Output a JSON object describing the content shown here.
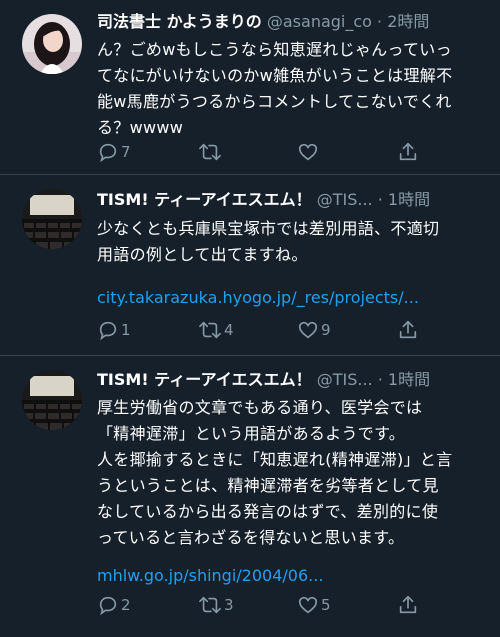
{
  "colors": {
    "background": "#15202b",
    "text": "#ffffff",
    "muted": "#8899a6",
    "link": "#1da1f2",
    "divider": "#38444d"
  },
  "tweets": [
    {
      "name": "司法書士 かようまりの",
      "handle": "@asanagi_co",
      "separator": "·",
      "time": "2時間",
      "text": "ん？ごめwもしこうなら知恵遅れじゃんっていっ\nてなにがいけないのかw雑魚がいうことは理解不\n能w馬鹿がうつるからコメントしてこないでくれ\nる？wwww",
      "link": "",
      "reply_count": "7",
      "retweet_count": "",
      "like_count": "",
      "avatar": "woman-portrait"
    },
    {
      "name": "TISM! ティーアイエスエム！",
      "handle": "@TIS...",
      "separator": "·",
      "time": "1時間",
      "text": "少なくとも兵庫県宝塚市では差別用語、不適切\n用語の例として出てますね。",
      "link": "city.takarazuka.hyogo.jp/_res/projects/...",
      "reply_count": "1",
      "retweet_count": "4",
      "like_count": "9",
      "avatar": "cinema-seats"
    },
    {
      "name": "TISM! ティーアイエスエム！",
      "handle": "@TIS...",
      "separator": "·",
      "time": "1時間",
      "text": "厚生労働省の文章でもある通り、医学会では\n「精神遅滞」という用語があるようです。\n人を揶揄するときに「知恵遅れ(精神遅滞)」と言\nうということは、精神遅滞者を劣等者として見\nなしているから出る発言のはずで、差別的に使\nっていると言わざるを得ないと思います。",
      "link": "mhlw.go.jp/shingi/2004/06...",
      "reply_count": "2",
      "retweet_count": "3",
      "like_count": "5",
      "avatar": "cinema-seats"
    }
  ]
}
